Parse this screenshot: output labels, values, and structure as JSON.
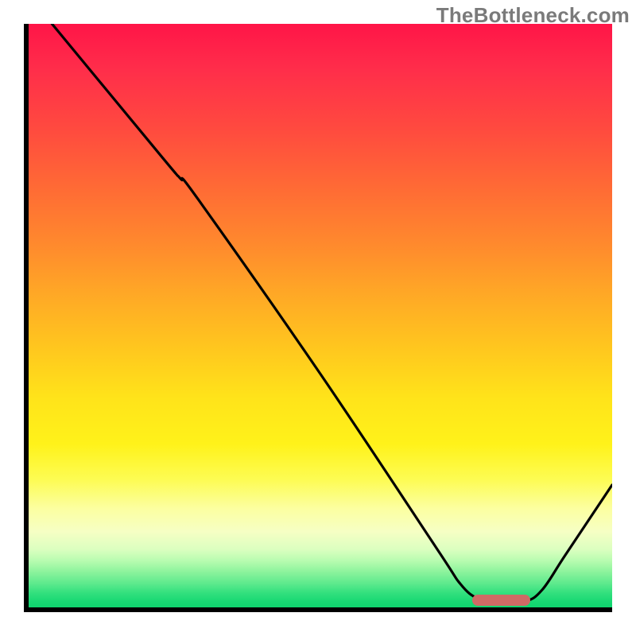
{
  "watermark": "TheBottleneck.com",
  "chart_data": {
    "type": "line",
    "title": "",
    "xlabel": "",
    "ylabel": "",
    "xlim": [
      0,
      100
    ],
    "ylim": [
      0,
      100
    ],
    "series": [
      {
        "name": "bottleneck-curve",
        "points": [
          {
            "x": 4,
            "y": 100
          },
          {
            "x": 23,
            "y": 77
          },
          {
            "x": 26,
            "y": 73.5
          },
          {
            "x": 29,
            "y": 70
          },
          {
            "x": 50,
            "y": 40
          },
          {
            "x": 70,
            "y": 10
          },
          {
            "x": 74,
            "y": 4
          },
          {
            "x": 77,
            "y": 1.5
          },
          {
            "x": 80.5,
            "y": 0.8
          },
          {
            "x": 85,
            "y": 1
          },
          {
            "x": 88,
            "y": 3
          },
          {
            "x": 92,
            "y": 9
          },
          {
            "x": 100,
            "y": 21
          }
        ]
      }
    ],
    "marker": {
      "name": "optimal-range",
      "x_start": 76,
      "x_end": 86,
      "y": 1.2,
      "color": "#cf6a65"
    },
    "gradient_stops": [
      {
        "pct": 0,
        "color": "#ff1548"
      },
      {
        "pct": 50,
        "color": "#ffc81e"
      },
      {
        "pct": 80,
        "color": "#fdfc52"
      },
      {
        "pct": 100,
        "color": "#0fd46e"
      }
    ]
  }
}
